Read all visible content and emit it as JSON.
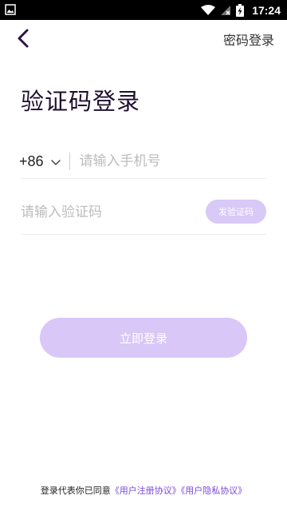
{
  "status_bar": {
    "time": "17:24",
    "icons": [
      "image-notification-icon",
      "wifi-icon",
      "no-signal-icon",
      "battery-charging-icon"
    ]
  },
  "header": {
    "back_icon": "chevron-left-icon",
    "password_login_label": "密码登录"
  },
  "page_title": "验证码登录",
  "phone": {
    "country_code": "+86",
    "placeholder": "请输入手机号",
    "value": ""
  },
  "code": {
    "placeholder": "请输入验证码",
    "value": "",
    "send_code_label": "发验证码"
  },
  "login_button_label": "立即登录",
  "agreement": {
    "prefix": "登录代表你已同意",
    "user_agreement": "《用户注册协议》",
    "privacy_agreement": "《用户隐私协议》"
  },
  "colors": {
    "accent": "#7b47db",
    "button_disabled": "#d8c7f7",
    "title": "#1e0f2e"
  }
}
